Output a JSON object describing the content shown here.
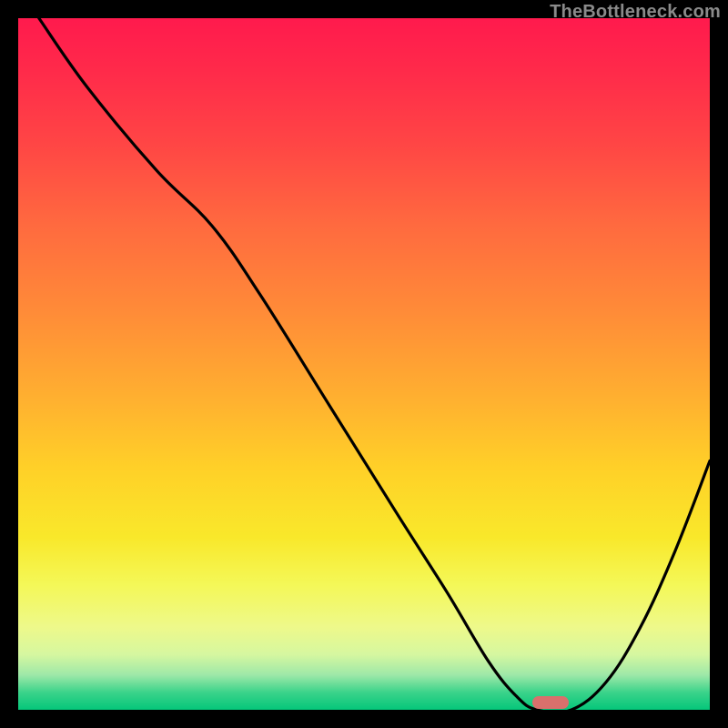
{
  "watermark": "TheBottleneck.com",
  "chart_data": {
    "type": "line",
    "title": "",
    "xlabel": "",
    "ylabel": "",
    "xlim": [
      0,
      100
    ],
    "ylim": [
      0,
      100
    ],
    "grid": false,
    "series": [
      {
        "name": "curve",
        "x": [
          3,
          10,
          20,
          28,
          35,
          45,
          55,
          62,
          68,
          72,
          75,
          80,
          85,
          90,
          95,
          100
        ],
        "y": [
          100,
          90,
          78,
          70,
          60,
          44,
          28,
          17,
          7,
          2,
          0,
          0,
          4,
          12,
          23,
          36
        ]
      }
    ],
    "marker": {
      "x": 77,
      "y": 1,
      "color": "#d9706c"
    },
    "background_gradient_stops": [
      {
        "pos": 0,
        "color": "#ff1a4d"
      },
      {
        "pos": 0.5,
        "color": "#ffb030"
      },
      {
        "pos": 0.85,
        "color": "#f4f858"
      },
      {
        "pos": 1.0,
        "color": "#05c67a"
      }
    ]
  }
}
